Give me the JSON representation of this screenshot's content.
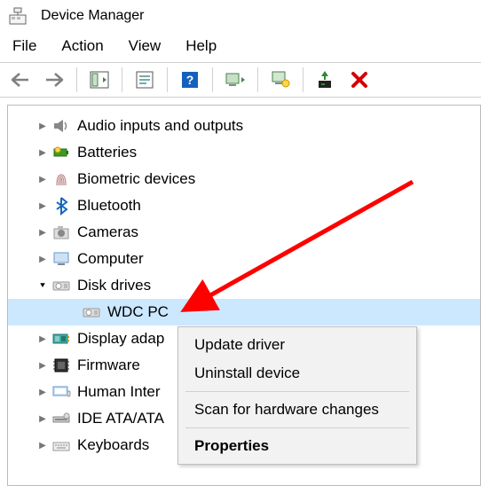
{
  "window": {
    "title": "Device Manager"
  },
  "menu": {
    "file": "File",
    "action": "Action",
    "view": "View",
    "help": "Help"
  },
  "tree": {
    "audio": "Audio inputs and outputs",
    "batteries": "Batteries",
    "biometric": "Biometric devices",
    "bluetooth": "Bluetooth",
    "cameras": "Cameras",
    "computer": "Computer",
    "diskdrives": "Disk drives",
    "disk_child": "WDC PC",
    "display": "Display adap",
    "firmware": "Firmware",
    "hid": "Human Inter",
    "ide": "IDE ATA/ATA",
    "keyboards": "Keyboards"
  },
  "context_menu": {
    "update": "Update driver",
    "uninstall": "Uninstall device",
    "scan": "Scan for hardware changes",
    "properties": "Properties"
  },
  "colors": {
    "selection": "#cce8ff",
    "arrow": "#ff0000"
  }
}
